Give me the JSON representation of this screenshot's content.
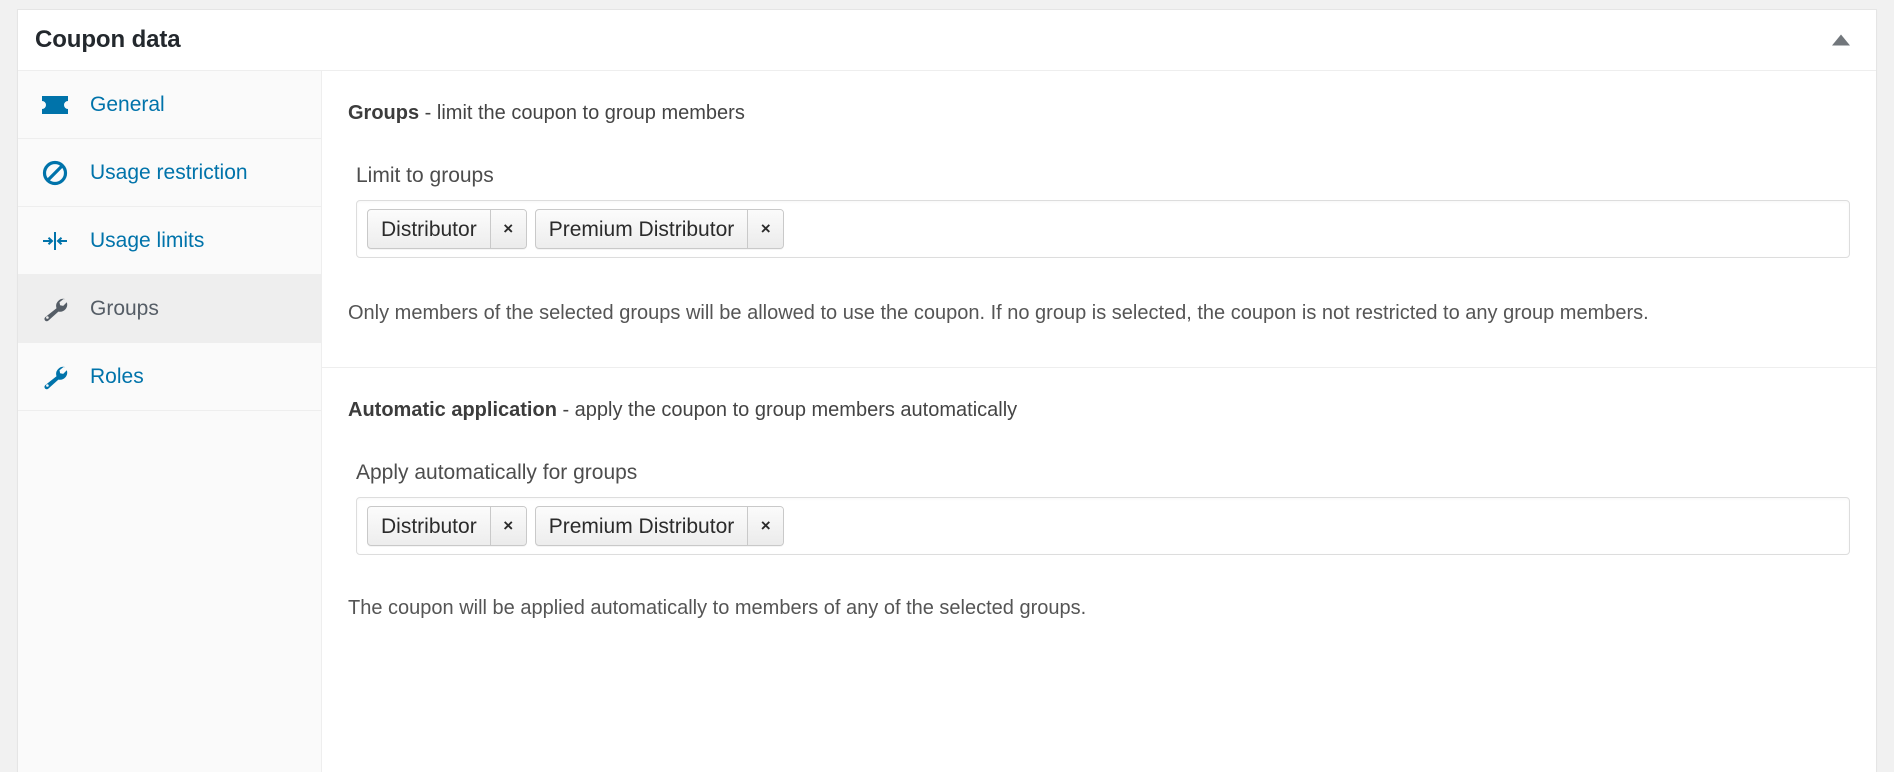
{
  "panel": {
    "title": "Coupon data",
    "toggle_icon": "triangle-up-icon"
  },
  "sidebar": {
    "items": [
      {
        "label": "General",
        "icon": "ticket-icon",
        "active": false
      },
      {
        "label": "Usage restriction",
        "icon": "block-icon",
        "active": false
      },
      {
        "label": "Usage limits",
        "icon": "limits-icon",
        "active": false
      },
      {
        "label": "Groups",
        "icon": "wrench-icon",
        "active": true
      },
      {
        "label": "Roles",
        "icon": "wrench-icon",
        "active": false
      }
    ]
  },
  "sections": [
    {
      "heading_bold": "Groups",
      "heading_rest": " - limit the coupon to group members",
      "field_label": "Limit to groups",
      "tokens": [
        "Distributor",
        "Premium Distributor"
      ],
      "remove_glyph": "×",
      "help": "Only members of the selected groups will be allowed to use the coupon. If no group is selected, the coupon is not restricted to any group members."
    },
    {
      "heading_bold": "Automatic application",
      "heading_rest": " - apply the coupon to group members automatically",
      "field_label": "Apply automatically for groups",
      "tokens": [
        "Distributor",
        "Premium Distributor"
      ],
      "remove_glyph": "×",
      "help": "The coupon will be applied automatically to members of any of the selected groups."
    }
  ],
  "colors": {
    "link_blue": "#0073aa",
    "active_bg": "#eeeeee",
    "sidebar_bg": "#fafafa",
    "panel_border": "#e5e5e5",
    "text_dark": "#23282d",
    "help_text": "#555555"
  }
}
